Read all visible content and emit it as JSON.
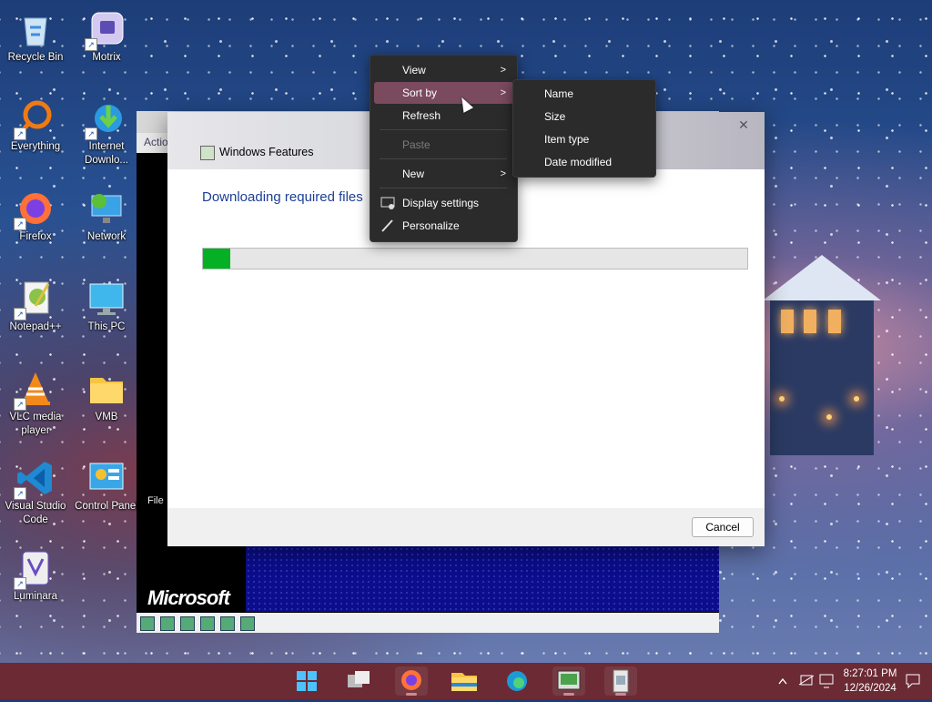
{
  "desktop": {
    "icons": [
      {
        "label": "Recycle Bin",
        "icon": "recycle-bin-icon"
      },
      {
        "label": "Motrix",
        "icon": "motrix-icon"
      },
      {
        "label": "Everything",
        "icon": "everything-search-icon"
      },
      {
        "label": "Internet Downlo...",
        "icon": "internet-download-manager-icon"
      },
      {
        "label": "Firefox",
        "icon": "firefox-icon"
      },
      {
        "label": "Network",
        "icon": "network-icon"
      },
      {
        "label": "Notepad++",
        "icon": "notepad-plus-plus-icon"
      },
      {
        "label": "This PC",
        "icon": "this-pc-icon"
      },
      {
        "label": "VLC media player",
        "icon": "vlc-icon"
      },
      {
        "label": "VMB",
        "icon": "folder-icon"
      },
      {
        "label": "Visual Studio Code",
        "icon": "vscode-icon"
      },
      {
        "label": "Control Panel",
        "icon": "control-panel-icon"
      },
      {
        "label": "Luminara",
        "icon": "luminara-icon"
      }
    ]
  },
  "vm_window": {
    "action_text": "Actio",
    "file_text": "File",
    "logo_text": "Microsoft"
  },
  "dialog": {
    "title": "Windows Features",
    "heading": "Downloading required files",
    "progress_percent": 5,
    "cancel_label": "Cancel",
    "close_glyph": "✕"
  },
  "context_menu": {
    "items": [
      {
        "label": "View",
        "has_submenu": true
      },
      {
        "label": "Sort by",
        "has_submenu": true,
        "highlighted": true
      },
      {
        "label": "Refresh"
      },
      {
        "label": "Paste",
        "disabled": true
      },
      {
        "label": "New",
        "has_submenu": true
      },
      {
        "label": "Display settings",
        "icon": "display-settings-icon"
      },
      {
        "label": "Personalize",
        "icon": "personalize-brush-icon"
      }
    ],
    "submenu": {
      "items": [
        "Name",
        "Size",
        "Item type",
        "Date modified"
      ]
    }
  },
  "taskbar": {
    "apps": [
      "start-icon",
      "task-view-icon",
      "firefox-icon",
      "file-explorer-icon",
      "edge-icon",
      "vm-app-icon",
      "installer-icon"
    ],
    "clock_time": "8:27:01 PM",
    "clock_date": "12/26/2024"
  },
  "colors": {
    "taskbar": "#6b2a34",
    "menu_bg": "#2b2b2b",
    "menu_highlight": "#7a4a5e",
    "progress_fill": "#06b025",
    "heading": "#1c3f94"
  }
}
